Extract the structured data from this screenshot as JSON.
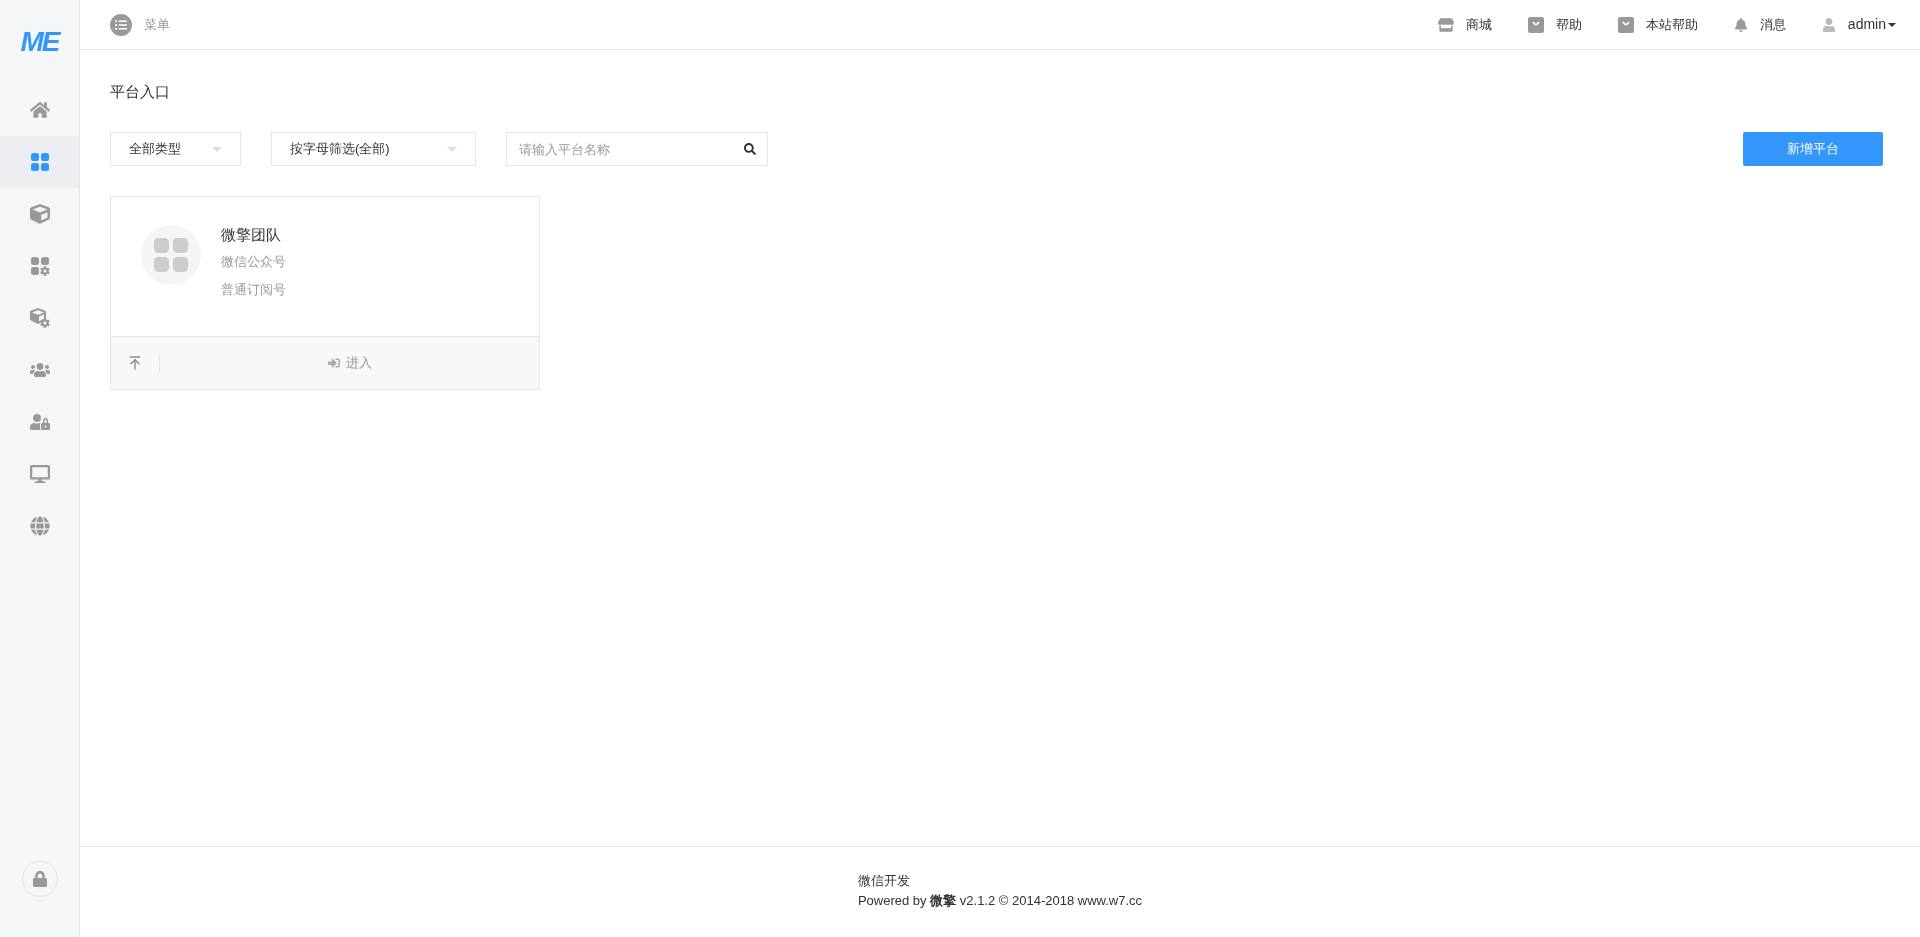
{
  "logo": "ME",
  "sidebar": {
    "items": [
      {
        "kind": "home",
        "selected": false
      },
      {
        "kind": "apps",
        "selected": true
      },
      {
        "kind": "cube",
        "selected": false
      },
      {
        "kind": "apps-gear",
        "selected": false
      },
      {
        "kind": "cube-gear",
        "selected": false
      },
      {
        "kind": "users",
        "selected": false
      },
      {
        "kind": "user-lock",
        "selected": false
      },
      {
        "kind": "monitor",
        "selected": false
      },
      {
        "kind": "globe",
        "selected": false
      }
    ],
    "lock": {
      "kind": "lock"
    }
  },
  "topbar": {
    "menu": "菜单",
    "links": [
      {
        "kind": "store",
        "label": "商城"
      },
      {
        "kind": "bag",
        "label": "帮助"
      },
      {
        "kind": "bag",
        "label": "本站帮助"
      },
      {
        "kind": "bell",
        "label": "消息"
      }
    ],
    "user": "admin"
  },
  "page_title": "平台入口",
  "filters": {
    "type_select": "全部类型",
    "letter_select": "按字母筛选(全部)",
    "search": {
      "placeholder": "请输入平台名称"
    }
  },
  "add_button": "新增平台",
  "cards": [
    {
      "name": "微擎团队",
      "type": "微信公众号",
      "level": "普通订阅号",
      "enter": "进入"
    }
  ],
  "footer": {
    "line1": "微信开发",
    "line2": "Powered by **微擎** v2.1.2 © 2014-2018 www.w7.cc"
  }
}
